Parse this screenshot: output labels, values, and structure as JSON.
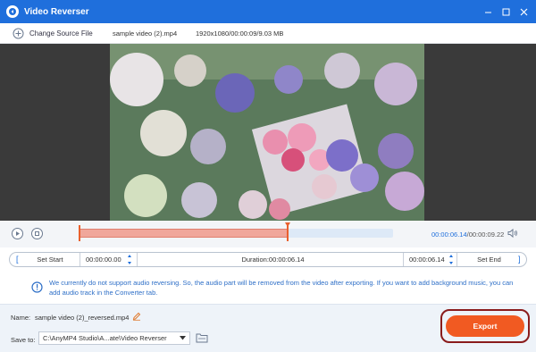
{
  "window": {
    "title": "Video Reverser"
  },
  "topbar": {
    "change_source_label": "Change Source File",
    "file_name": "sample video (2).mp4",
    "file_info": "1920x1080/00:00:09/9.03 MB"
  },
  "player": {
    "current_time": "00:00:06.14",
    "total_time": "/00:00:09.22",
    "selection_fraction": 0.666
  },
  "range": {
    "set_start_label": "Set Start",
    "start_time": "00:00:00.00",
    "duration_text": "Duration:00:00:06.14",
    "end_time": "00:00:06.14",
    "set_end_label": "Set End"
  },
  "notice": {
    "text": "We currently do not support audio reversing. So, the audio part will be removed from the video after exporting. If you want to add background music, you can add audio track in the Converter tab."
  },
  "output": {
    "name_label": "Name:",
    "name_value": "sample video (2)_reversed.mp4",
    "save_to_label": "Save to:",
    "save_path": "C:\\AnyMP4 Studio\\A...ate\\Video Reverser",
    "export_label": "Export"
  },
  "colors": {
    "accent": "#1f6fdc",
    "export": "#f15a22",
    "selection": "#f0a79b"
  }
}
